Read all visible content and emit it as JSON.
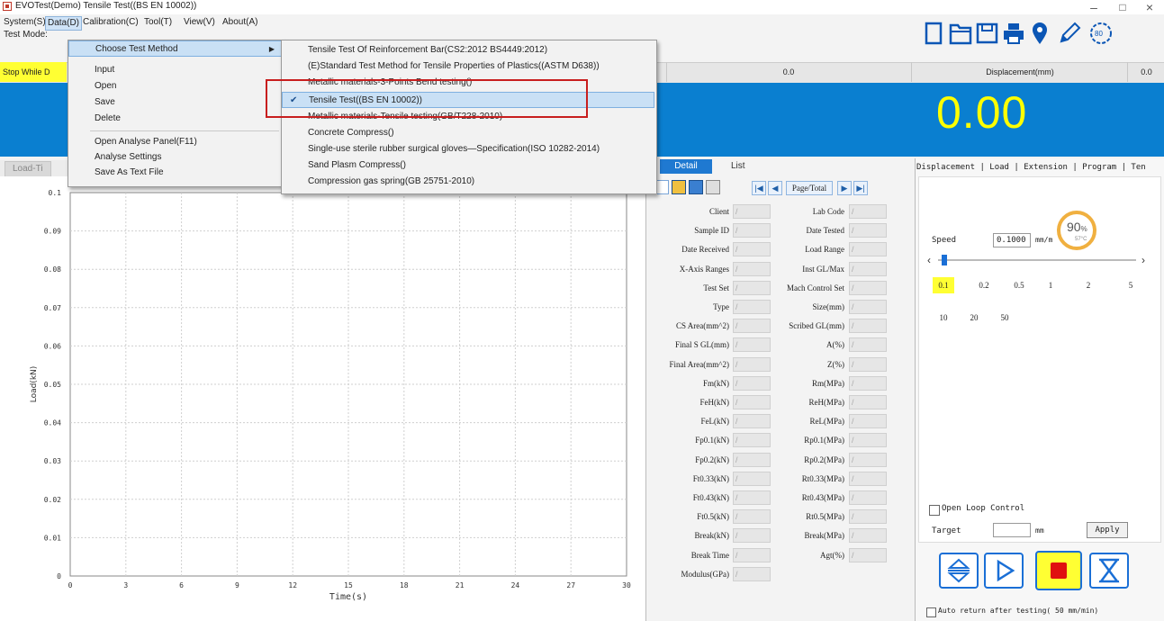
{
  "window": {
    "title": "EVOTest(Demo) Tensile Test((BS EN 10002))",
    "minimize": "–",
    "maximize": "□",
    "close": "×"
  },
  "menubar": {
    "items": [
      "System(S)",
      "Data(D)",
      "Calibration(C)",
      "Tool(T)",
      "View(V)",
      "About(A)"
    ],
    "test_mode_label": "Test Mode:"
  },
  "toolbar_icons": [
    "new-icon",
    "open-icon",
    "save-icon",
    "print-icon",
    "location-icon",
    "edit-icon",
    "speed-icon"
  ],
  "status": {
    "stop_while": "Stop While D",
    "reading_left_value": "0.0",
    "displacement_label": "Displacement(mm)",
    "displacement_value": "0.0"
  },
  "display": {
    "left_partial": ")",
    "right_value": "0.00"
  },
  "left_tab": "Load-Ti",
  "data_menu": {
    "choose": "Choose Test Method",
    "items": [
      "Input",
      "Open",
      "Save",
      "Delete"
    ],
    "items2": [
      "Open Analyse Panel(F11)",
      "Analyse Settings",
      "Save As Text File"
    ]
  },
  "test_methods": [
    "Tensile Test Of Reinforcement Bar(CS2:2012  BS4449:2012)",
    "(E)Standard Test Method for Tensile Properties of Plastics((ASTM D638))",
    "Metallic materials-3-Points Bend testing()",
    "Tensile Test((BS EN 10002))",
    "Metallic materials-Tensile testing(GB/T228-2010)",
    "Concrete Compress()",
    "Single-use sterile rubber surgical gloves—Specification(ISO 10282-2014)",
    "Sand Plasm Compress()",
    "Compression gas spring(GB 25751-2010)"
  ],
  "selected_test_method": "Tensile Test((BS EN 10002))",
  "chart_data": {
    "type": "line",
    "title": "",
    "xlabel": "Time(s)",
    "ylabel": "Load(kN)",
    "xlim": [
      0,
      30
    ],
    "ylim": [
      0,
      0.1
    ],
    "x_ticks": [
      "0",
      "3",
      "6",
      "9",
      "12",
      "15",
      "18",
      "21",
      "24",
      "27",
      "30"
    ],
    "y_ticks": [
      "0",
      "0.01",
      "0.02",
      "0.03",
      "0.04",
      "0.05",
      "0.06",
      "0.07",
      "0.08",
      "0.09",
      "0.1"
    ],
    "grid": true,
    "series": []
  },
  "detail": {
    "tab_detail": "Detail",
    "tab_list": "List",
    "page_total": "Page/Total",
    "left_fields": [
      "Client",
      "Sample ID",
      "Date Received",
      "X-Axis Ranges",
      "Test Set",
      "Type",
      "CS Area(mm^2)",
      "Final S GL(mm)",
      "Final Area(mm^2)",
      "Fm(kN)",
      "FeH(kN)",
      "FeL(kN)",
      "Fp0.1(kN)",
      "Fp0.2(kN)",
      "Ft0.33(kN)",
      "Ft0.43(kN)",
      "Ft0.5(kN)",
      "Break(kN)",
      "Break Time",
      "Modulus(GPa)"
    ],
    "right_fields": [
      "Lab Code",
      "Date Tested",
      "Load Range",
      "Inst GL/Max",
      "Mach Control Set",
      "Size(mm)",
      "Scribed GL(mm)",
      "A(%)",
      "Z(%)",
      "Rm(MPa)",
      "ReH(MPa)",
      "ReL(MPa)",
      "Rp0.1(MPa)",
      "Rp0.2(MPa)",
      "Rt0.33(MPa)",
      "Rt0.43(MPa)",
      "Rt0.5(MPa)",
      "Break(MPa)",
      "Agt(%)"
    ]
  },
  "right_panel": {
    "tabs": "Displacement | Load | Extension | Program | Ten",
    "speed_label": "Speed",
    "speed_value": "0.1000",
    "speed_unit": "mm/m",
    "gauge_percent": "90",
    "gauge_percent_sign": "%",
    "gauge_temp": "57°C",
    "speed_options": [
      "0.1",
      "0.2",
      "0.5",
      "1",
      "2",
      "5",
      "10",
      "20",
      "50"
    ],
    "open_loop": "Open Loop Control",
    "target_label": "Target",
    "target_unit": "mm",
    "apply": "Apply",
    "auto_return": "Auto return after testing( 50   mm/min)"
  }
}
